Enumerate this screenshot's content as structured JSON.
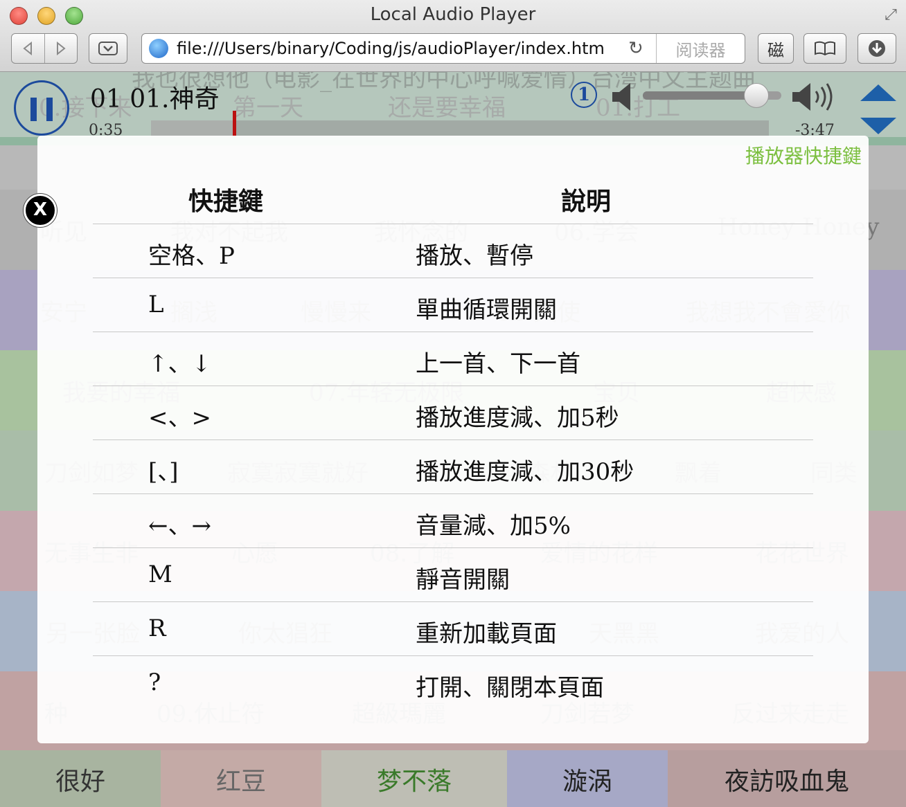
{
  "window": {
    "title": "Local Audio Player"
  },
  "toolbar": {
    "url": "file:///Users/binary/Coding/js/audioPlayer/index.htm",
    "reader_label": "阅读器",
    "tool_a_label": "磁"
  },
  "player": {
    "background_title": "我也很想他（电影_在世界的中心呼喊爱情）台湾中文主题曲",
    "track_title": "01 01.神奇",
    "elapsed": "0:35",
    "remaining": "-3:47",
    "progress_fraction": 0.135,
    "loop_badge": "1",
    "volume_fraction": 0.82,
    "accent_color": "#1c4a9c"
  },
  "grid": {
    "rows": [
      {
        "bg": "#8fb59e",
        "cells": [
          "0.接下来",
          "第一天",
          "还是要幸福",
          "01.打工"
        ]
      },
      {
        "bg": "#b0b0b0",
        "cells": [
          "听见",
          "我对不起我",
          "我怀念的",
          "06.学会",
          "Honey Honey"
        ]
      },
      {
        "bg": "#a8a2c0",
        "cells": [
          "安宁",
          "搁浅",
          "慢慢来",
          "08.天使",
          "我想我不會愛你"
        ]
      },
      {
        "bg": "#a8c29e",
        "cells": [
          "我要的幸福",
          "07.年轻无极限",
          "宝贝",
          "超快感"
        ]
      },
      {
        "bg": "#a9bda8",
        "cells": [
          "刀剑如梦",
          "寂寞寂寞就好",
          "04.森林",
          "飘着",
          "同类"
        ]
      },
      {
        "bg": "#c4a7ad",
        "cells": [
          "无事生非",
          "心愿",
          "08.了解",
          "爱情的花样",
          "花花世界"
        ]
      },
      {
        "bg": "#a7b4c7",
        "cells": [
          "另一张脸",
          "你太猖狂",
          "02.冰雨",
          "天黑黑",
          "我爱的人"
        ]
      },
      {
        "bg": "#c0a2a2",
        "cells": [
          "种",
          "09.休止符",
          "超級瑪麗",
          "刀剑若梦",
          "反过来走走"
        ]
      }
    ],
    "bottom": [
      {
        "label": "很好",
        "bg": "#a8b4a0",
        "color": "#333"
      },
      {
        "label": "红豆",
        "bg": "#c4aaa6",
        "color": "#666"
      },
      {
        "label": "梦不落",
        "bg": "#bebeb4",
        "color": "#3a7a2a"
      },
      {
        "label": "漩涡",
        "bg": "#a6a8c6",
        "color": "#222"
      },
      {
        "label": "夜訪吸血鬼",
        "bg": "#b79e9e",
        "color": "#222"
      }
    ]
  },
  "shortcuts": {
    "heading": "播放器快捷鍵",
    "col_key": "快捷鍵",
    "col_desc": "說明",
    "close_label": "X",
    "rows": [
      {
        "key": "空格、P",
        "desc": "播放、暫停"
      },
      {
        "key": "L",
        "desc": "單曲循環開關"
      },
      {
        "key": "↑、↓",
        "desc": "上一首、下一首"
      },
      {
        "key": "<、>",
        "desc": "播放進度減、加5秒"
      },
      {
        "key": "[、]",
        "desc": "播放進度減、加30秒"
      },
      {
        "key": "←、→",
        "desc": "音量減、加5%"
      },
      {
        "key": "M",
        "desc": "靜音開關"
      },
      {
        "key": "R",
        "desc": "重新加載頁面"
      },
      {
        "key": "?",
        "desc": "打開、關閉本頁面"
      }
    ]
  }
}
